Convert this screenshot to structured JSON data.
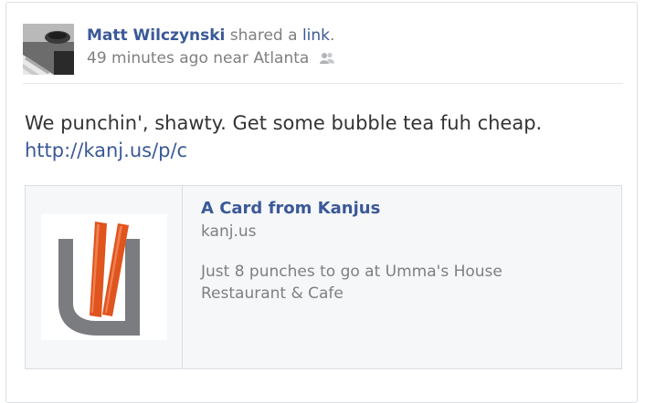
{
  "post": {
    "author": "Matt Wilczynski",
    "action_prefix": "shared a",
    "action_link": "link",
    "action_suffix": ".",
    "timestamp": "49 minutes ago",
    "location": "near Atlanta",
    "privacy_icon": "friends-icon",
    "message": "We punchin', shawty. Get some bubble tea fuh cheap.",
    "message_link": "http://kanj.us/p/c"
  },
  "attachment": {
    "title": "A Card from Kanjus",
    "domain": "kanj.us",
    "description_line1": "Just 8 punches to go at Umma's House",
    "description_line2": "Restaurant & Cafe",
    "logo_icon": "kanjus-logo"
  },
  "colors": {
    "link": "#3b5998",
    "muted": "#7f7f7f",
    "body_text": "#333333",
    "attachment_bg": "#f6f7f9",
    "logo_gray": "#7b7c80",
    "logo_orange": "#e0541e"
  }
}
